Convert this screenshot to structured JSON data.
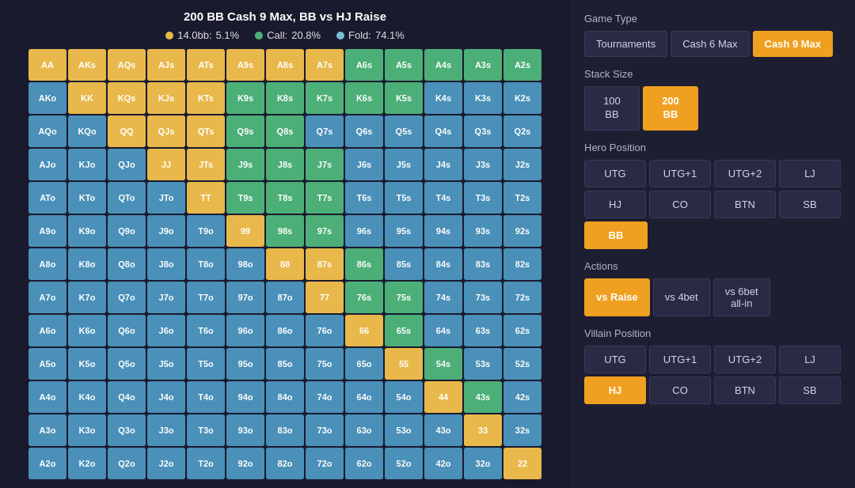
{
  "title": "200 BB Cash 9 Max, BB vs HJ Raise",
  "legend": {
    "raise": {
      "label": "14.0bb:",
      "pct": "5.1%",
      "color": "#e8b84b"
    },
    "call": {
      "label": "Call:",
      "pct": "20.8%",
      "color": "#4caf78"
    },
    "fold": {
      "label": "Fold:",
      "pct": "74.1%",
      "color": "#7bbcd5"
    }
  },
  "gameType": {
    "label": "Game Type",
    "options": [
      "Tournaments",
      "Cash 6 Max",
      "Cash 9 Max"
    ],
    "active": "Cash 9 Max"
  },
  "stackSize": {
    "label": "Stack Size",
    "options": [
      {
        "label": "100\nBB"
      },
      {
        "label": "200\nBB"
      }
    ],
    "active": "200\nBB"
  },
  "heroPosition": {
    "label": "Hero Position",
    "options": [
      "UTG",
      "UTG+1",
      "UTG+2",
      "LJ",
      "HJ",
      "CO",
      "BTN",
      "SB",
      "BB"
    ],
    "active": "BB"
  },
  "actions": {
    "label": "Actions",
    "options": [
      "vs Raise",
      "vs 4bet",
      "vs 6bet\nall-in"
    ],
    "active": "vs Raise"
  },
  "villainPosition": {
    "label": "Villain Position",
    "options": [
      "UTG",
      "UTG+1",
      "UTG+2",
      "LJ",
      "HJ",
      "CO",
      "BTN",
      "SB"
    ],
    "active": "HJ"
  },
  "grid": {
    "rows": [
      [
        "AA",
        "AKs",
        "AQs",
        "AJs",
        "ATs",
        "A9s",
        "A8s",
        "A7s",
        "A6s",
        "A5s",
        "A4s",
        "A3s",
        "A2s"
      ],
      [
        "AKo",
        "KK",
        "KQs",
        "KJs",
        "KTs",
        "K9s",
        "K8s",
        "K7s",
        "K6s",
        "K5s",
        "K4s",
        "K3s",
        "K2s"
      ],
      [
        "AQo",
        "KQo",
        "QQ",
        "QJs",
        "QTs",
        "Q9s",
        "Q8s",
        "Q7s",
        "Q6s",
        "Q5s",
        "Q4s",
        "Q3s",
        "Q2s"
      ],
      [
        "AJo",
        "KJo",
        "QJo",
        "JJ",
        "JTs",
        "J9s",
        "J8s",
        "J7s",
        "J6s",
        "J5s",
        "J4s",
        "J3s",
        "J2s"
      ],
      [
        "ATo",
        "KTo",
        "QTo",
        "JTo",
        "TT",
        "T9s",
        "T8s",
        "T7s",
        "T6s",
        "T5s",
        "T4s",
        "T3s",
        "T2s"
      ],
      [
        "A9o",
        "K9o",
        "Q9o",
        "J9o",
        "T9o",
        "99",
        "98s",
        "97s",
        "96s",
        "95s",
        "94s",
        "93s",
        "92s"
      ],
      [
        "A8o",
        "K8o",
        "Q8o",
        "J8o",
        "T8o",
        "98o",
        "88",
        "87s",
        "86s",
        "85s",
        "84s",
        "83s",
        "82s"
      ],
      [
        "A7o",
        "K7o",
        "Q7o",
        "J7o",
        "T7o",
        "97o",
        "87o",
        "77",
        "76s",
        "75s",
        "74s",
        "73s",
        "72s"
      ],
      [
        "A6o",
        "K6o",
        "Q6o",
        "J6o",
        "T6o",
        "96o",
        "86o",
        "76o",
        "66",
        "65s",
        "64s",
        "63s",
        "62s"
      ],
      [
        "A5o",
        "K5o",
        "Q5o",
        "J5o",
        "T5o",
        "95o",
        "85o",
        "75o",
        "65o",
        "55",
        "54s",
        "53s",
        "52s"
      ],
      [
        "A4o",
        "K4o",
        "Q4o",
        "J4o",
        "T4o",
        "94o",
        "84o",
        "74o",
        "64o",
        "54o",
        "44",
        "43s",
        "42s"
      ],
      [
        "A3o",
        "K3o",
        "Q3o",
        "J3o",
        "T3o",
        "93o",
        "83o",
        "73o",
        "63o",
        "53o",
        "43o",
        "33",
        "32s"
      ],
      [
        "A2o",
        "K2o",
        "Q2o",
        "J2o",
        "T2o",
        "92o",
        "82o",
        "72o",
        "62o",
        "52o",
        "42o",
        "32o",
        "22"
      ]
    ],
    "colors": [
      [
        "c-yellow",
        "c-yellow",
        "c-yellow",
        "c-yellow",
        "c-yellow",
        "c-yellow",
        "c-yellow",
        "c-yellow",
        "c-green",
        "c-green",
        "c-green",
        "c-green",
        "c-green"
      ],
      [
        "c-blue",
        "c-yellow",
        "c-yellow",
        "c-yellow",
        "c-yellow",
        "c-green",
        "c-green",
        "c-green",
        "c-green",
        "c-green",
        "c-blue",
        "c-blue",
        "c-blue"
      ],
      [
        "c-blue",
        "c-blue",
        "c-yellow",
        "c-yellow",
        "c-yellow",
        "c-green",
        "c-green",
        "c-blue",
        "c-blue",
        "c-blue",
        "c-blue",
        "c-blue",
        "c-blue"
      ],
      [
        "c-blue",
        "c-blue",
        "c-blue",
        "c-yellow",
        "c-yellow",
        "c-green",
        "c-green",
        "c-green",
        "c-blue",
        "c-blue",
        "c-blue",
        "c-blue",
        "c-blue"
      ],
      [
        "c-blue",
        "c-blue",
        "c-blue",
        "c-blue",
        "c-yellow",
        "c-green",
        "c-green",
        "c-green",
        "c-blue",
        "c-blue",
        "c-blue",
        "c-blue",
        "c-blue"
      ],
      [
        "c-blue",
        "c-blue",
        "c-blue",
        "c-blue",
        "c-blue",
        "c-yellow",
        "c-green",
        "c-green",
        "c-blue",
        "c-blue",
        "c-blue",
        "c-blue",
        "c-blue"
      ],
      [
        "c-blue",
        "c-blue",
        "c-blue",
        "c-blue",
        "c-blue",
        "c-blue",
        "c-yellow",
        "c-yellow",
        "c-green",
        "c-blue",
        "c-blue",
        "c-blue",
        "c-blue"
      ],
      [
        "c-blue",
        "c-blue",
        "c-blue",
        "c-blue",
        "c-blue",
        "c-blue",
        "c-blue",
        "c-yellow",
        "c-green",
        "c-green",
        "c-blue",
        "c-blue",
        "c-blue"
      ],
      [
        "c-blue",
        "c-blue",
        "c-blue",
        "c-blue",
        "c-blue",
        "c-blue",
        "c-blue",
        "c-blue",
        "c-yellow",
        "c-green",
        "c-blue",
        "c-blue",
        "c-blue"
      ],
      [
        "c-blue",
        "c-blue",
        "c-blue",
        "c-blue",
        "c-blue",
        "c-blue",
        "c-blue",
        "c-blue",
        "c-blue",
        "c-yellow",
        "c-green",
        "c-blue",
        "c-blue"
      ],
      [
        "c-blue",
        "c-blue",
        "c-blue",
        "c-blue",
        "c-blue",
        "c-blue",
        "c-blue",
        "c-blue",
        "c-blue",
        "c-blue",
        "c-yellow",
        "c-green",
        "c-blue"
      ],
      [
        "c-blue",
        "c-blue",
        "c-blue",
        "c-blue",
        "c-blue",
        "c-blue",
        "c-blue",
        "c-blue",
        "c-blue",
        "c-blue",
        "c-blue",
        "c-yellow",
        "c-blue"
      ],
      [
        "c-blue",
        "c-blue",
        "c-blue",
        "c-blue",
        "c-blue",
        "c-blue",
        "c-blue",
        "c-blue",
        "c-blue",
        "c-blue",
        "c-blue",
        "c-blue",
        "c-yellow"
      ]
    ]
  }
}
